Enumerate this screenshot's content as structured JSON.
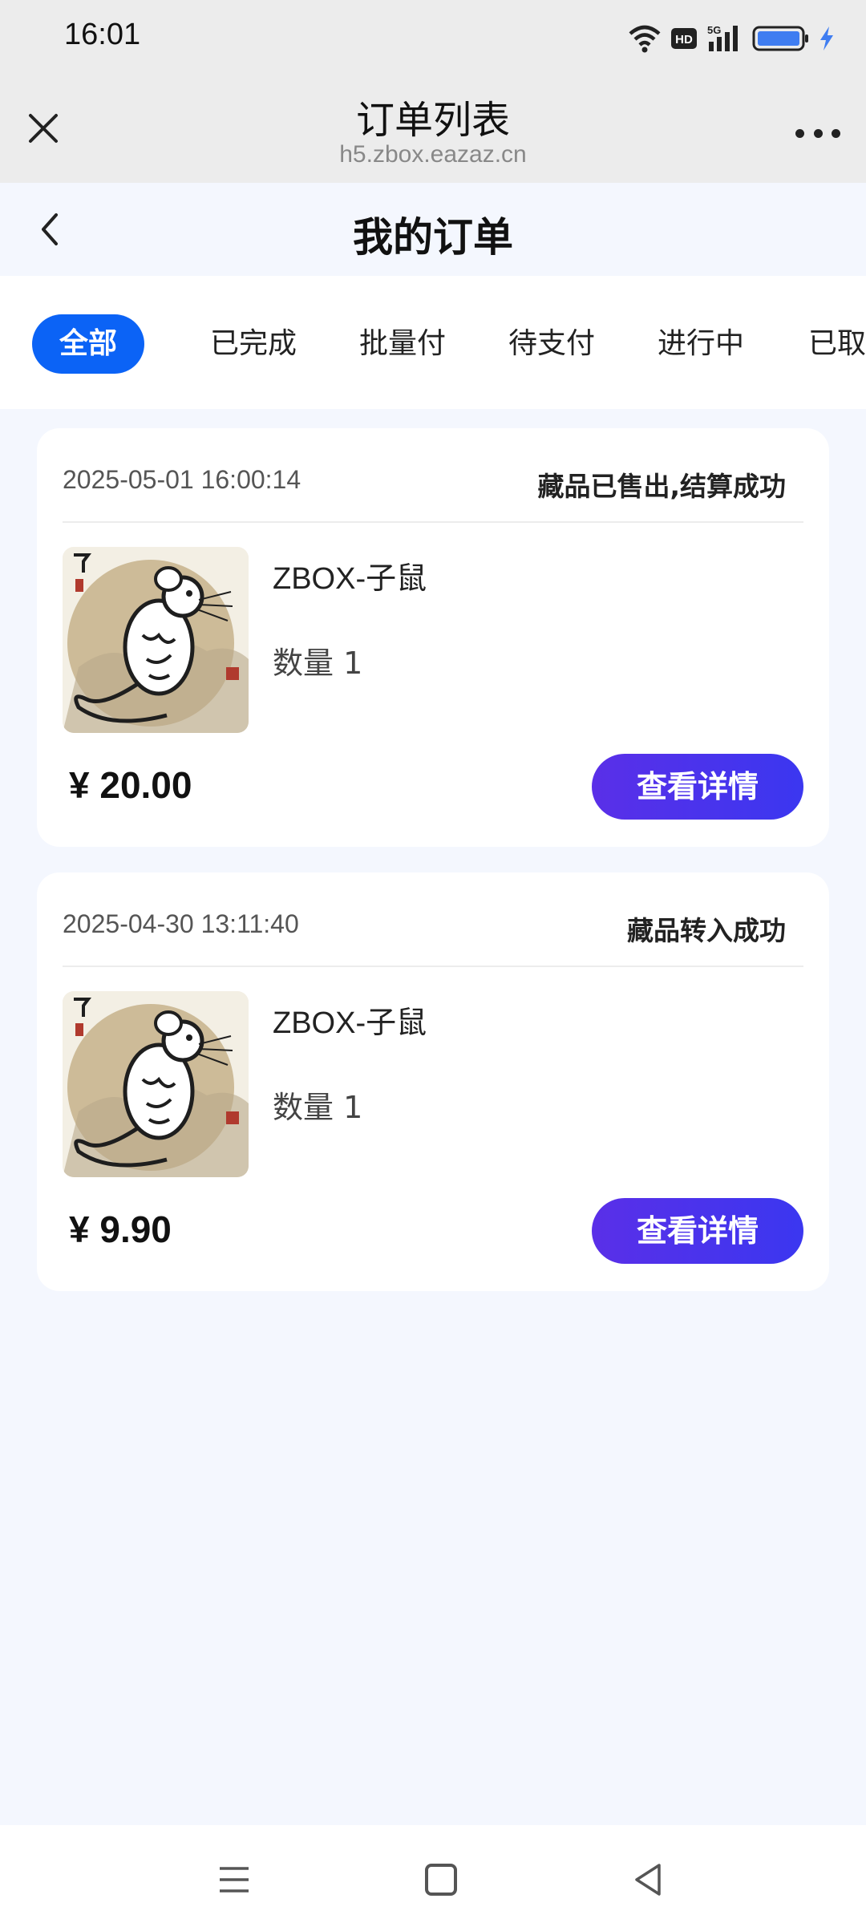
{
  "status_bar": {
    "time": "16:01",
    "network": "5G",
    "hd": "HD"
  },
  "browser": {
    "title": "订单列表",
    "url": "h5.zbox.eazaz.cn"
  },
  "page": {
    "title": "我的订单"
  },
  "tabs": [
    {
      "label": "全部",
      "active": true
    },
    {
      "label": "已完成"
    },
    {
      "label": "批量付"
    },
    {
      "label": "待支付"
    },
    {
      "label": "进行中"
    },
    {
      "label": "已取消"
    }
  ],
  "orders": [
    {
      "date": "2025-05-01 16:00:14",
      "status": "藏品已售出,结算成功",
      "product": "ZBOX-子鼠",
      "quantity": "数量 1",
      "price": "¥ 20.00",
      "button": "查看详情"
    },
    {
      "date": "2025-04-30 13:11:40",
      "status": "藏品转入成功",
      "product": "ZBOX-子鼠",
      "quantity": "数量 1",
      "price": "¥ 9.90",
      "button": "查看详情"
    }
  ],
  "colors": {
    "accent": "#0b63f6",
    "button_start": "#5a2fe8",
    "button_end": "#3b37f0",
    "page_bg": "#f4f7fe"
  },
  "icons": [
    "wifi-icon",
    "hd-icon",
    "signal-icon",
    "battery-icon",
    "charging-icon",
    "close-icon",
    "more-icon",
    "back-icon",
    "nav-menu-icon",
    "nav-home-icon",
    "nav-back-icon"
  ]
}
